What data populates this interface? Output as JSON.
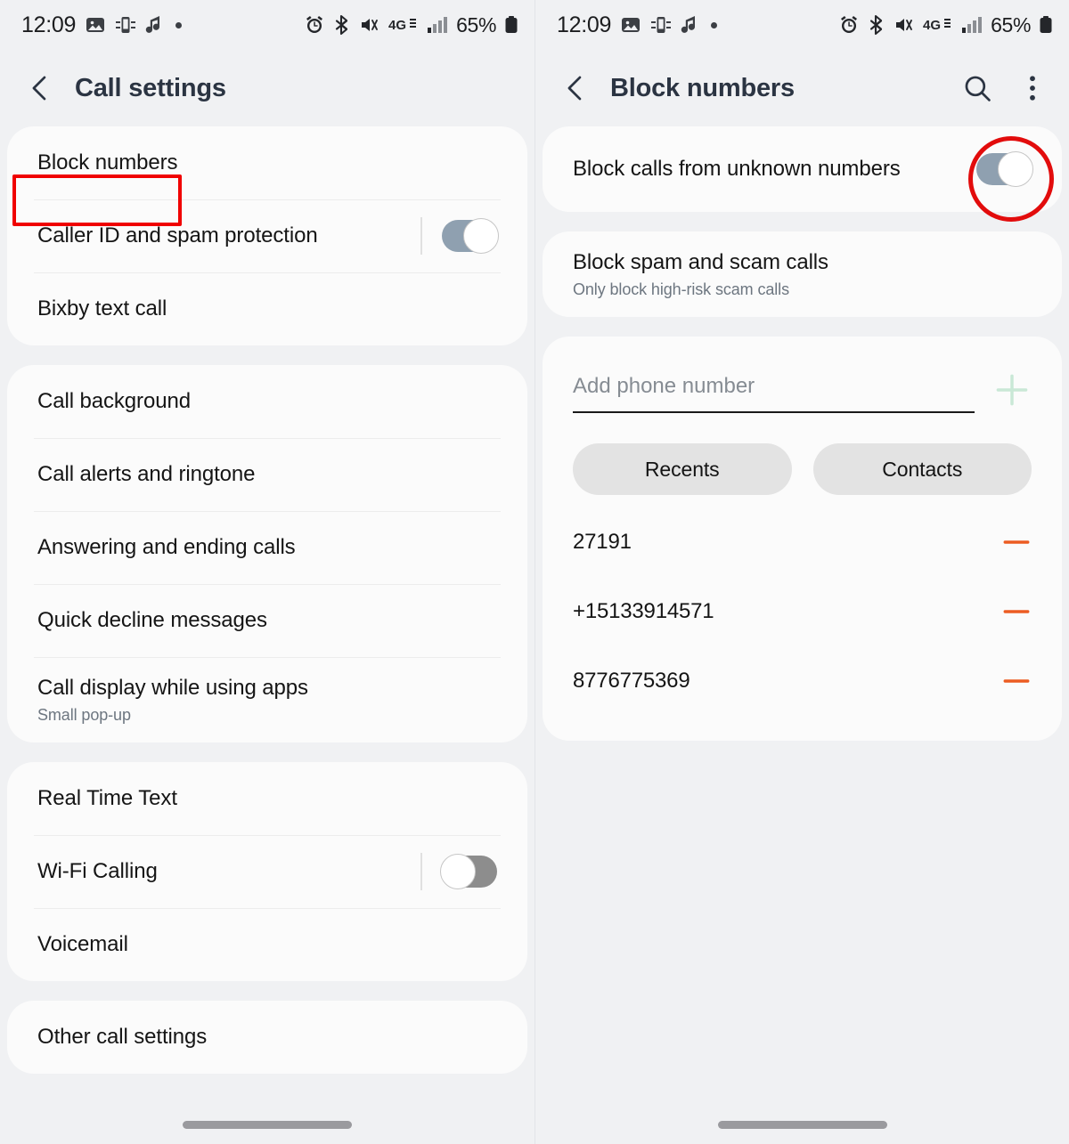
{
  "status_bar": {
    "time": "12:09",
    "battery": "65%",
    "left_icons": [
      "gallery-icon",
      "screen-mirror-icon",
      "music-note-icon",
      "status-dot-icon"
    ],
    "right_icons": [
      "alarm-icon",
      "bluetooth-icon",
      "mute-vibrate-icon",
      "network-4g-icon",
      "signal-bars-icon",
      "battery-icon"
    ]
  },
  "left_screen": {
    "title": "Call settings",
    "back_icon": "chevron-left-icon",
    "group1": [
      {
        "label": "Block numbers",
        "type": "link",
        "highlighted": true
      },
      {
        "label": "Caller ID and spam protection",
        "type": "toggle",
        "toggle_state": "on"
      },
      {
        "label": "Bixby text call",
        "type": "link"
      }
    ],
    "group2": [
      {
        "label": "Call background",
        "type": "link"
      },
      {
        "label": "Call alerts and ringtone",
        "type": "link"
      },
      {
        "label": "Answering and ending calls",
        "type": "link"
      },
      {
        "label": "Quick decline messages",
        "type": "link"
      },
      {
        "label": "Call display while using apps",
        "sub": "Small pop-up",
        "type": "link"
      }
    ],
    "group3": [
      {
        "label": "Real Time Text",
        "type": "link"
      },
      {
        "label": "Wi-Fi Calling",
        "type": "toggle",
        "toggle_state": "off"
      },
      {
        "label": "Voicemail",
        "type": "link"
      }
    ],
    "group4": [
      {
        "label": "Other call settings",
        "type": "link"
      }
    ]
  },
  "right_screen": {
    "title": "Block numbers",
    "back_icon": "chevron-left-icon",
    "search_icon": "search-icon",
    "more_icon": "overflow-menu-icon",
    "unknown_row": {
      "label": "Block calls from unknown numbers",
      "toggle_state": "on",
      "annotated": true
    },
    "spam_row": {
      "label": "Block spam and scam calls",
      "sub": "Only block high-risk scam calls"
    },
    "add_number": {
      "placeholder": "Add phone number",
      "value": "",
      "add_icon": "plus-icon"
    },
    "chips": [
      {
        "label": "Recents"
      },
      {
        "label": "Contacts"
      }
    ],
    "blocked_numbers": [
      {
        "number": "27191",
        "remove_icon": "minus-icon"
      },
      {
        "number": "+15133914571",
        "remove_icon": "minus-icon"
      },
      {
        "number": "8776775369",
        "remove_icon": "minus-icon"
      }
    ]
  },
  "colors": {
    "annotation_red": "#e20c0c",
    "toggle_on": "#8fa0b0",
    "toggle_off": "#8d8d8d",
    "remove_orange": "#ec5c22",
    "add_green": "#c9e8d6",
    "title_navy": "#2b3442",
    "page_bg": "#f0f1f3",
    "card_bg": "#fbfbfb"
  }
}
